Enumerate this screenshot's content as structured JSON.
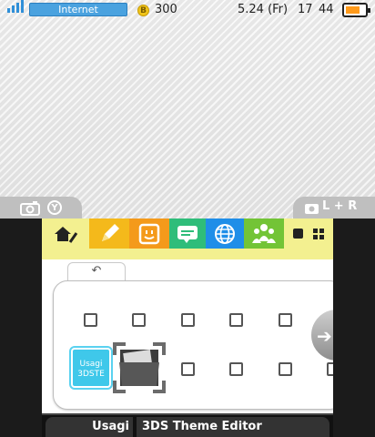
{
  "status": {
    "connection_label": "Internet",
    "coin_icon_text": "B",
    "coin_count": "300",
    "date": "5.24 (Fr)",
    "time_hour": "17",
    "time_min": "44",
    "battery_level": 0.75,
    "icons": [
      "signal-icon",
      "coin-icon",
      "battery-icon"
    ]
  },
  "snap": {
    "left_button": "Y",
    "right_buttons": "L + R"
  },
  "apps": [
    {
      "name": "home-settings",
      "color": "#f3f090",
      "icon": "home-tool-icon"
    },
    {
      "name": "notes",
      "color": "#f4b91b",
      "icon": "pencil-icon"
    },
    {
      "name": "mii",
      "color": "#f49a1b",
      "icon": "smiley-icon"
    },
    {
      "name": "miiverse",
      "color": "#2fbd7a",
      "icon": "speech-bubble-icon"
    },
    {
      "name": "browser",
      "color": "#1f8ee8",
      "icon": "globe-icon"
    },
    {
      "name": "friends",
      "color": "#73c436",
      "icon": "friends-icon"
    }
  ],
  "folder": {
    "back_symbol": "↶",
    "app_icon_line1": "Usagi",
    "app_icon_line2": "3DSTE"
  },
  "title": {
    "left": "Usagi",
    "right": "3DS Theme Editor"
  }
}
